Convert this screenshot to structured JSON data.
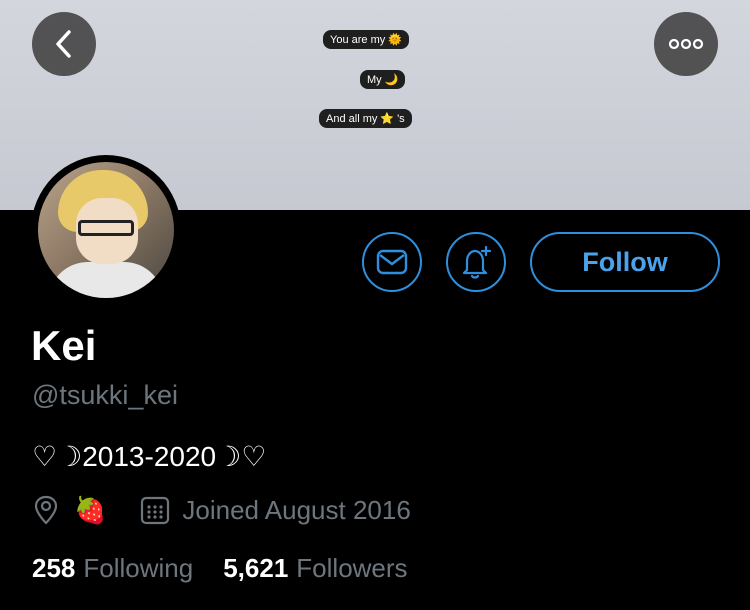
{
  "banner": {
    "messages": [
      {
        "text": "You are my",
        "emoji": "🌞"
      },
      {
        "text": "My",
        "emoji": "🌙"
      },
      {
        "text": "And all my",
        "emoji": "⭐",
        "suffix": "'s"
      }
    ]
  },
  "nav": {
    "back_icon": "chevron-left-icon",
    "more_icon": "ellipsis-icon"
  },
  "actions": {
    "follow_label": "Follow",
    "message_icon": "envelope-icon",
    "notify_icon": "bell-plus-icon"
  },
  "profile": {
    "name": "Kei",
    "handle": "@tsukki_kei",
    "bio": "♡☽2013-2020☽♡",
    "location": "🍓",
    "joined": "Joined August 2016"
  },
  "stats": {
    "following_count": "258",
    "following_label": "Following",
    "followers_count": "5,621",
    "followers_label": "Followers"
  },
  "colors": {
    "accent": "#2f8fde",
    "muted": "#6e767d",
    "background": "#000000"
  }
}
